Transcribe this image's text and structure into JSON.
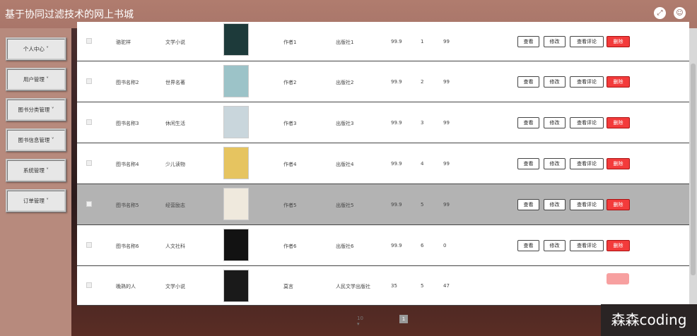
{
  "app": {
    "title": "基于协同过滤技术的网上书城"
  },
  "header": {
    "fullscreen_icon": "fullscreen-icon",
    "user_icon": "user-icon"
  },
  "sidebar": {
    "items": [
      {
        "label": "个人中心 ˅"
      },
      {
        "label": "用户管理 ˅"
      },
      {
        "label": "图书分类管理 ˅"
      },
      {
        "label": "图书信息管理 ˅"
      },
      {
        "label": "系统管理 ˅"
      },
      {
        "label": "订单管理 ˅"
      }
    ]
  },
  "actions": {
    "view": "查看",
    "edit": "修改",
    "reviews": "查看评论",
    "delete": "删除"
  },
  "rows": [
    {
      "name": "骆驼祥",
      "category": "文学小说",
      "author": "作者1",
      "publisher": "出版社1",
      "price": "99.9",
      "n1": "1",
      "n2": "99",
      "cover": "#1d3a3a"
    },
    {
      "name": "图书名称2",
      "category": "世界名著",
      "author": "作者2",
      "publisher": "出版社2",
      "price": "99.9",
      "n1": "2",
      "n2": "99",
      "cover": "#9cc3c8"
    },
    {
      "name": "图书名称3",
      "category": "休闲生活",
      "author": "作者3",
      "publisher": "出版社3",
      "price": "99.9",
      "n1": "3",
      "n2": "99",
      "cover": "#c9d6dc"
    },
    {
      "name": "图书名称4",
      "category": "少儿读物",
      "author": "作者4",
      "publisher": "出版社4",
      "price": "99.9",
      "n1": "4",
      "n2": "99",
      "cover": "#e6c460"
    },
    {
      "name": "图书名称5",
      "category": "经营励志",
      "author": "作者5",
      "publisher": "出版社5",
      "price": "99.9",
      "n1": "5",
      "n2": "99",
      "cover": "#efe9dd"
    },
    {
      "name": "图书名称6",
      "category": "人文社科",
      "author": "作者6",
      "publisher": "出版社6",
      "price": "99.9",
      "n1": "6",
      "n2": "0",
      "cover": "#121212"
    },
    {
      "name": "晚熟的人",
      "category": "文学小说",
      "author": "莫言",
      "publisher": "人民文学出版社",
      "price": "35",
      "n1": "5",
      "n2": "47",
      "cover": "#1a1a1a"
    }
  ],
  "pager": {
    "page_size": "10",
    "current_page": "1"
  },
  "watermark": "森森coding"
}
